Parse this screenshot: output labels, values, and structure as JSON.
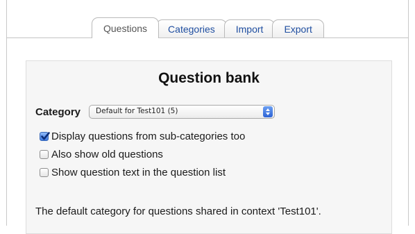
{
  "tabs": [
    {
      "label": "Questions",
      "active": true
    },
    {
      "label": "Categories",
      "active": false
    },
    {
      "label": "Import",
      "active": false
    },
    {
      "label": "Export",
      "active": false
    }
  ],
  "panel": {
    "title": "Question bank",
    "category_label": "Category",
    "category_select": {
      "selected": "Default for Test101 (5)",
      "icon": "select-arrows-icon"
    },
    "options": [
      {
        "label": "Display questions from sub-categories too",
        "checked": true
      },
      {
        "label": "Also show old questions",
        "checked": false
      },
      {
        "label": "Show question text in the question list",
        "checked": false
      }
    ],
    "description": "The default category for questions shared in context 'Test101'."
  },
  "colors": {
    "tab_link": "#1f4ea0",
    "tab_active_text": "#555555",
    "panel_background": "#f6f6f6",
    "select_arrow_blue": "#2d63d5"
  }
}
